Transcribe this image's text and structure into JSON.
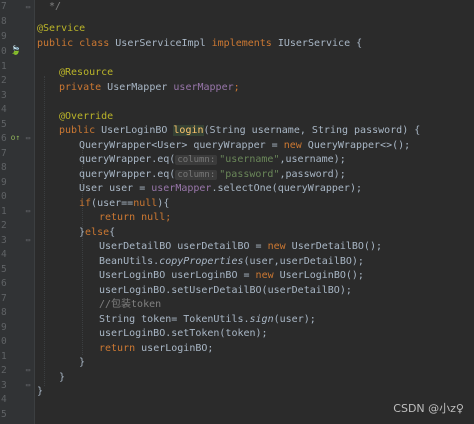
{
  "gutter": {
    "line_numbers": [
      "7",
      "8",
      "9",
      "0",
      "1",
      "2",
      "3",
      "4",
      "5",
      "6",
      "7",
      "8",
      "9",
      "0",
      "1",
      "2",
      "3",
      "4",
      "5",
      "6",
      "7",
      "8",
      "9",
      "0",
      "1",
      "2",
      "3",
      "4",
      "5",
      "6"
    ],
    "icons": {
      "spring_bean": "🍃",
      "override": "o↑"
    }
  },
  "code": {
    "l1_comment": "  */",
    "l2_annotation": "@Service",
    "l3": {
      "kw1": "public class ",
      "name": "UserServiceImpl ",
      "kw2": "implements ",
      "iface": "IUserService {"
    },
    "l5_annotation": "@Resource",
    "l6": {
      "kw": "private ",
      "type": "UserMapper ",
      "field": "userMapper",
      "end": ";"
    },
    "l8_annotation": "@Override",
    "l9": {
      "kw": "public ",
      "type": "UserLoginBO ",
      "method": "login",
      "params": "(String username, String password) {"
    },
    "l10": {
      "a": "QueryWrapper<User> queryWrapper = ",
      "kw": "new ",
      "b": "QueryWrapper<>();"
    },
    "l11": {
      "a": "queryWrapper.eq(",
      "hint": "column:",
      "str": "\"username\"",
      "b": ",username);"
    },
    "l12": {
      "a": "queryWrapper.eq(",
      "hint": "column:",
      "str": "\"password\"",
      "b": ",password);"
    },
    "l13": {
      "a": "User user = ",
      "field": "userMapper",
      "b": ".selectOne(queryWrapper);"
    },
    "l14": {
      "kw": "if",
      "a": "(user==",
      "kw2": "null",
      "b": "){"
    },
    "l15": {
      "kw": "return null",
      "b": ";"
    },
    "l16": {
      "a": "}",
      "kw": "else",
      "b": "{"
    },
    "l17": {
      "a": "UserDetailBO userDetailBO = ",
      "kw": "new ",
      "b": "UserDetailBO();"
    },
    "l18": {
      "a": "BeanUtils.",
      "method": "copyProperties",
      "b": "(user,userDetailBO);"
    },
    "l19": {
      "a": "UserLoginBO userLoginBO = ",
      "kw": "new ",
      "b": "UserLoginBO();"
    },
    "l20": "userLoginBO.setUserDetailBO(userDetailBO);",
    "l21_comment": "//包装token",
    "l22": {
      "a": "String token= TokenUtils.",
      "method": "sign",
      "b": "(user);"
    },
    "l23": "userLoginBO.setToken(token);",
    "l24": {
      "kw": "return ",
      "b": "userLoginBO;"
    },
    "l25": "}",
    "l26": "}",
    "l27": "}"
  },
  "watermark": "CSDN @小z♀",
  "colors": {
    "background": "#2b2b2b",
    "keyword": "#cc7832",
    "annotation": "#bbb529",
    "string": "#6a8759",
    "field": "#9876aa",
    "method": "#ffc66d",
    "comment": "#808080"
  }
}
